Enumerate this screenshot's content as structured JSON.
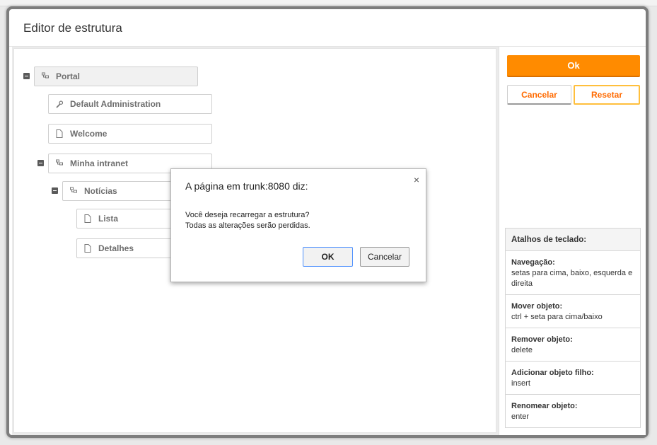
{
  "window": {
    "title": "Editor de estrutura"
  },
  "tree": {
    "nodes": [
      {
        "label": "Portal",
        "icon": "sitemap-icon"
      },
      {
        "label": "Default Administration",
        "icon": "wrench-icon"
      },
      {
        "label": "Welcome",
        "icon": "page-icon"
      },
      {
        "label": "Minha intranet",
        "icon": "sitemap-icon"
      },
      {
        "label": "Notícias",
        "icon": "sitemap-icon"
      },
      {
        "label": "Lista",
        "icon": "page-icon"
      },
      {
        "label": "Detalhes",
        "icon": "page-icon"
      }
    ]
  },
  "actions": {
    "ok_label": "Ok",
    "cancel_label": "Cancelar",
    "reset_label": "Resetar"
  },
  "shortcuts": {
    "header": "Atalhos de teclado:",
    "items": [
      {
        "title": "Navegação:",
        "desc": "setas para cima, baixo, esquerda e direita"
      },
      {
        "title": "Mover objeto:",
        "desc": "ctrl + seta para cima/baixo"
      },
      {
        "title": "Remover objeto:",
        "desc": "delete"
      },
      {
        "title": "Adicionar objeto filho:",
        "desc": "insert"
      },
      {
        "title": "Renomear objeto:",
        "desc": "enter"
      }
    ]
  },
  "dialog": {
    "title": "A página em trunk:8080 diz:",
    "message_line1": "Você deseja recarregar a estrutura?",
    "message_line2": "Todas as alterações serão perdidas.",
    "ok_label": "OK",
    "cancel_label": "Cancelar",
    "close_symbol": "×"
  },
  "colors": {
    "accent": "#ff8b00",
    "accent_text": "#ff6a00",
    "reset_border": "#ffbf3c"
  }
}
